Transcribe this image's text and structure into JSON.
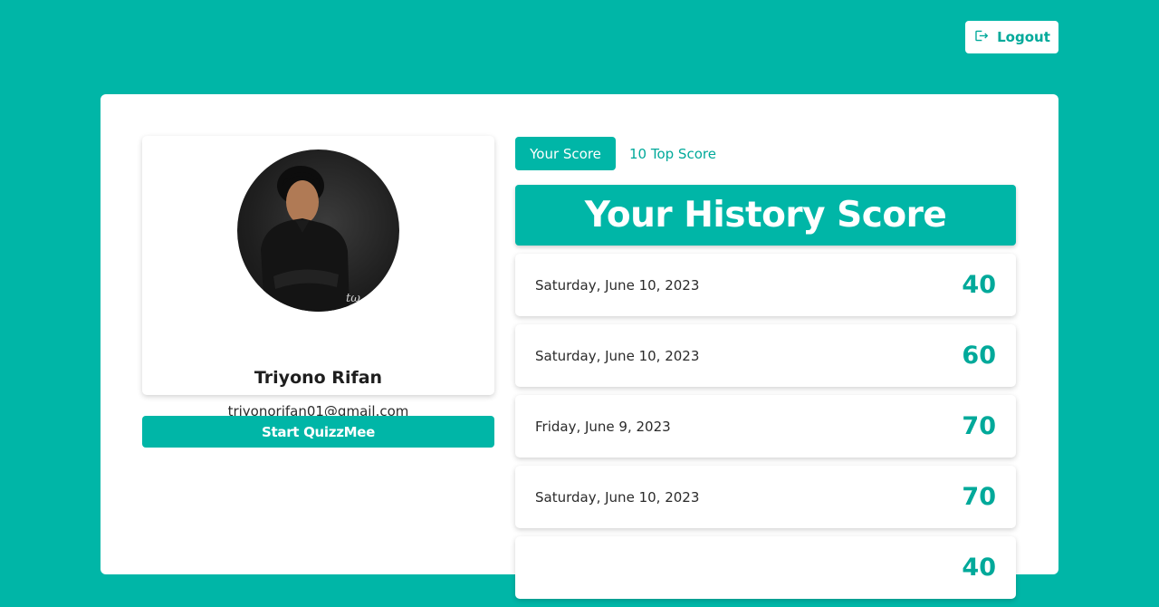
{
  "header": {
    "logout_label": "Logout"
  },
  "profile": {
    "name": "Triyono Rifan",
    "email": "triyonorifan01@gmail.com",
    "start_label": "Start QuizzMee"
  },
  "tabs": [
    {
      "label": "Your Score",
      "active": true
    },
    {
      "label": "10 Top Score",
      "active": false
    }
  ],
  "history": {
    "title": "Your History Score",
    "rows": [
      {
        "date": "Saturday, June 10, 2023",
        "score": "40"
      },
      {
        "date": "Saturday, June 10, 2023",
        "score": "60"
      },
      {
        "date": "Friday, June 9, 2023",
        "score": "70"
      },
      {
        "date": "Saturday, June 10, 2023",
        "score": "70"
      },
      {
        "date": "",
        "score": "40"
      }
    ]
  },
  "colors": {
    "primary": "#00b6a7",
    "primary_text": "#00a99a",
    "surface": "#ffffff"
  },
  "icons": {
    "logout": "logout-icon"
  }
}
